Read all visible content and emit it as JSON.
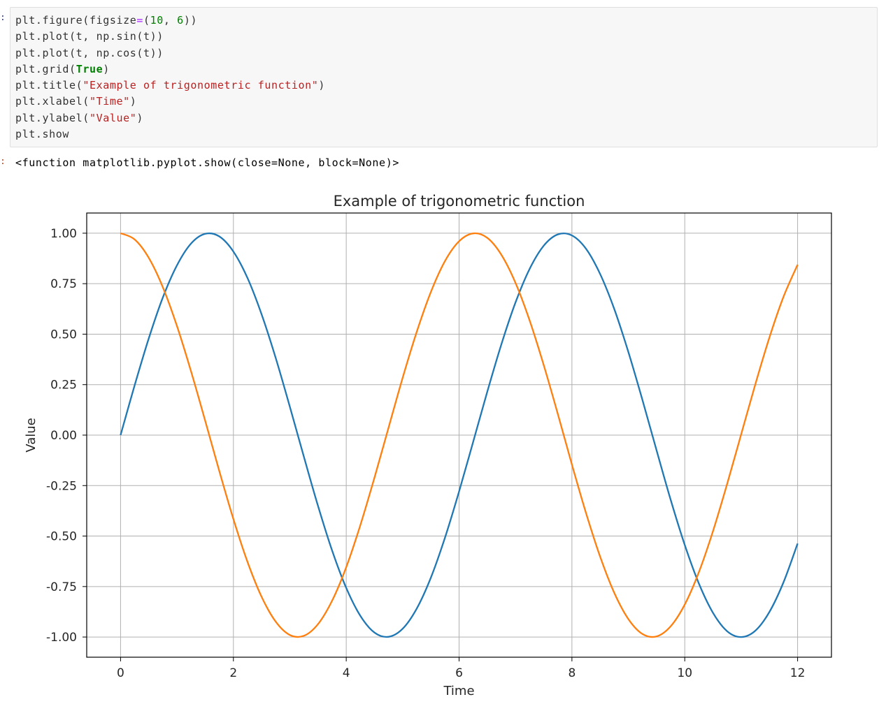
{
  "notebook": {
    "input_prompt": ":",
    "output_prompt": ":",
    "code_lines": [
      [
        {
          "t": "plt.figure(figsize"
        },
        {
          "t": "=",
          "c": "op"
        },
        {
          "t": "("
        },
        {
          "t": "10",
          "c": "num"
        },
        {
          "t": ", "
        },
        {
          "t": "6",
          "c": "num"
        },
        {
          "t": "))"
        }
      ],
      [
        {
          "t": "plt.plot(t, np.sin(t))"
        }
      ],
      [
        {
          "t": "plt.plot(t, np.cos(t))"
        }
      ],
      [
        {
          "t": "plt.grid("
        },
        {
          "t": "True",
          "c": "kw"
        },
        {
          "t": ")"
        }
      ],
      [
        {
          "t": "plt.title("
        },
        {
          "t": "\"Example of trigonometric function\"",
          "c": "str"
        },
        {
          "t": ")"
        }
      ],
      [
        {
          "t": "plt.xlabel("
        },
        {
          "t": "\"Time\"",
          "c": "str"
        },
        {
          "t": ")"
        }
      ],
      [
        {
          "t": "plt.ylabel("
        },
        {
          "t": "\"Value\"",
          "c": "str"
        },
        {
          "t": ")"
        }
      ],
      [
        {
          "t": "plt.show"
        }
      ]
    ],
    "output_text": "<function matplotlib.pyplot.show(close=None, block=None)>"
  },
  "chart_data": {
    "type": "line",
    "title": "Example of trigonometric function",
    "xlabel": "Time",
    "ylabel": "Value",
    "xlim": [
      -0.6,
      12.6
    ],
    "ylim": [
      -1.1,
      1.1
    ],
    "xticks": [
      0,
      2,
      4,
      6,
      8,
      10,
      12
    ],
    "xtick_labels": [
      "0",
      "2",
      "4",
      "6",
      "8",
      "10",
      "12"
    ],
    "yticks": [
      1.0,
      0.75,
      0.5,
      0.25,
      0.0,
      -0.25,
      -0.5,
      -0.75,
      -1.0
    ],
    "ytick_labels": [
      "1.00",
      "0.75",
      "0.50",
      "0.25",
      "0.00",
      "-0.25",
      "-0.50",
      "-0.75",
      "-1.00"
    ],
    "grid": true,
    "x": [
      0.0,
      0.25,
      0.5,
      0.75,
      1.0,
      1.25,
      1.5,
      1.75,
      2.0,
      2.25,
      2.5,
      2.75,
      3.0,
      3.25,
      3.5,
      3.75,
      4.0,
      4.25,
      4.5,
      4.75,
      5.0,
      5.25,
      5.5,
      5.75,
      6.0,
      6.25,
      6.5,
      6.75,
      7.0,
      7.25,
      7.5,
      7.75,
      8.0,
      8.25,
      8.5,
      8.75,
      9.0,
      9.25,
      9.5,
      9.75,
      10.0,
      10.25,
      10.5,
      10.75,
      11.0,
      11.25,
      11.5,
      11.75,
      12.0
    ],
    "series": [
      {
        "color": "#1f77b4",
        "values": [
          0.0,
          0.247,
          0.479,
          0.682,
          0.841,
          0.949,
          0.997,
          0.984,
          0.909,
          0.778,
          0.598,
          0.382,
          0.141,
          -0.108,
          -0.351,
          -0.572,
          -0.757,
          -0.895,
          -0.978,
          -0.999,
          -0.959,
          -0.859,
          -0.706,
          -0.508,
          -0.279,
          -0.033,
          0.215,
          0.45,
          0.657,
          0.823,
          0.938,
          0.994,
          0.989,
          0.923,
          0.798,
          0.625,
          0.412,
          0.174,
          -0.075,
          -0.32,
          -0.544,
          -0.735,
          -0.88,
          -0.971,
          -1.0,
          -0.969,
          -0.876,
          -0.729,
          -0.537
        ]
      },
      {
        "color": "#ff7f0e",
        "values": [
          1.0,
          0.969,
          0.878,
          0.732,
          0.54,
          0.315,
          0.071,
          -0.178,
          -0.416,
          -0.628,
          -0.801,
          -0.924,
          -0.99,
          -0.994,
          -0.936,
          -0.82,
          -0.654,
          -0.446,
          -0.211,
          0.037,
          0.284,
          0.512,
          0.709,
          0.862,
          0.96,
          0.999,
          0.977,
          0.893,
          0.754,
          0.568,
          0.347,
          0.105,
          -0.146,
          -0.386,
          -0.602,
          -0.781,
          -0.911,
          -0.985,
          -0.997,
          -0.947,
          -0.839,
          -0.679,
          -0.476,
          -0.243,
          0.004,
          0.251,
          0.483,
          0.685,
          0.844
        ]
      }
    ]
  },
  "colors": {
    "grid": "#b0b0b0",
    "axes": "#000000",
    "text": "#262626"
  }
}
